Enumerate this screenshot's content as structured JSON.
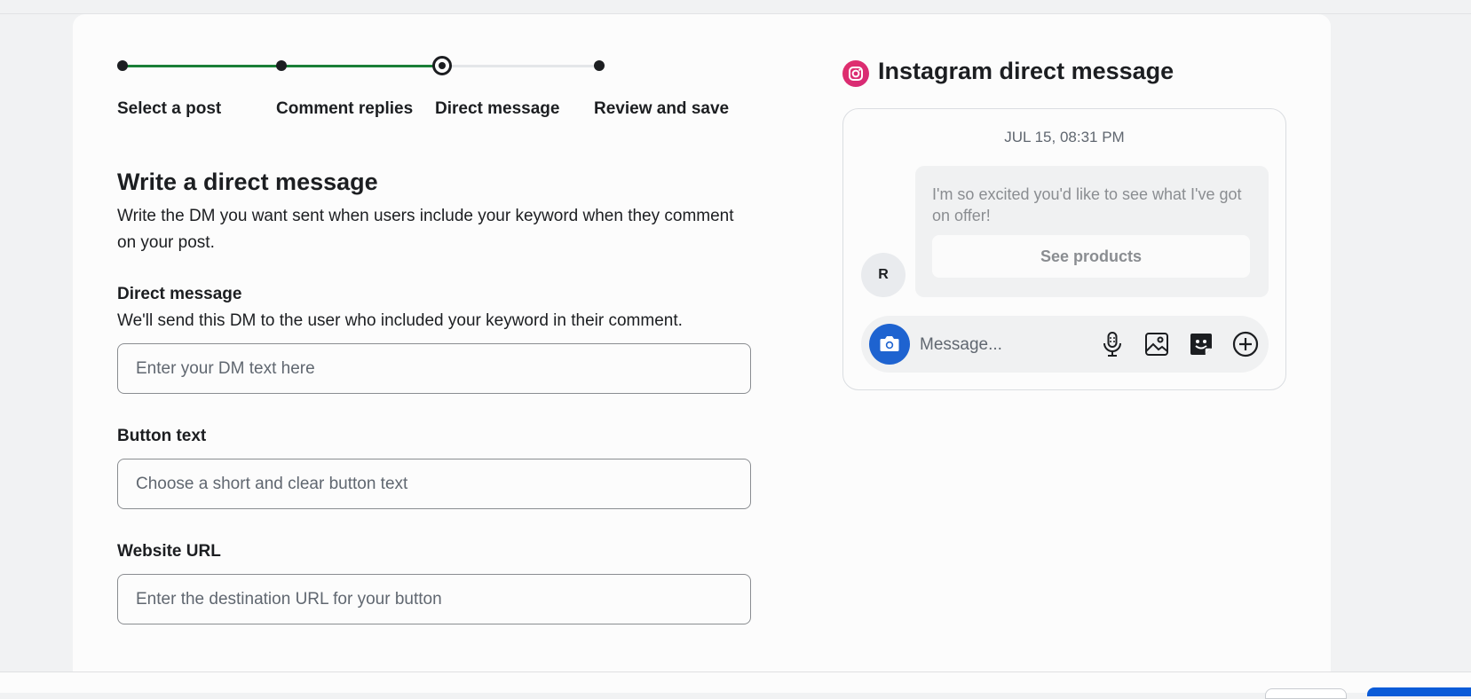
{
  "stepper": {
    "steps": [
      {
        "label": "Select a post",
        "status": "complete"
      },
      {
        "label": "Comment replies",
        "status": "complete"
      },
      {
        "label": "Direct message",
        "status": "current"
      },
      {
        "label": "Review and save",
        "status": "upcoming"
      }
    ],
    "complete_color": "#1a7f37",
    "upcoming_color": "#e4e6e9"
  },
  "section": {
    "title": "Write a direct message",
    "description": "Write the DM you want sent when users include your keyword when they comment on your post."
  },
  "fields": {
    "dm": {
      "label": "Direct message",
      "help": "We'll send this DM to the user who included your keyword in their comment.",
      "value": "",
      "placeholder": "Enter your DM text here"
    },
    "button_text": {
      "label": "Button text",
      "value": "",
      "placeholder": "Choose a short and clear button text"
    },
    "website_url": {
      "label": "Website URL",
      "value": "",
      "placeholder": "Enter the destination URL for your button"
    }
  },
  "preview": {
    "title": "Instagram direct message",
    "timestamp": "JUL 15, 08:31 PM",
    "avatar_initial": "R",
    "message": "I'm so excited you'd like to see what I've got on offer!",
    "button_label": "See products",
    "composer_placeholder": "Message...",
    "icons": [
      "camera-icon",
      "microphone-icon",
      "image-icon",
      "sticker-icon",
      "add-circle-icon"
    ]
  }
}
